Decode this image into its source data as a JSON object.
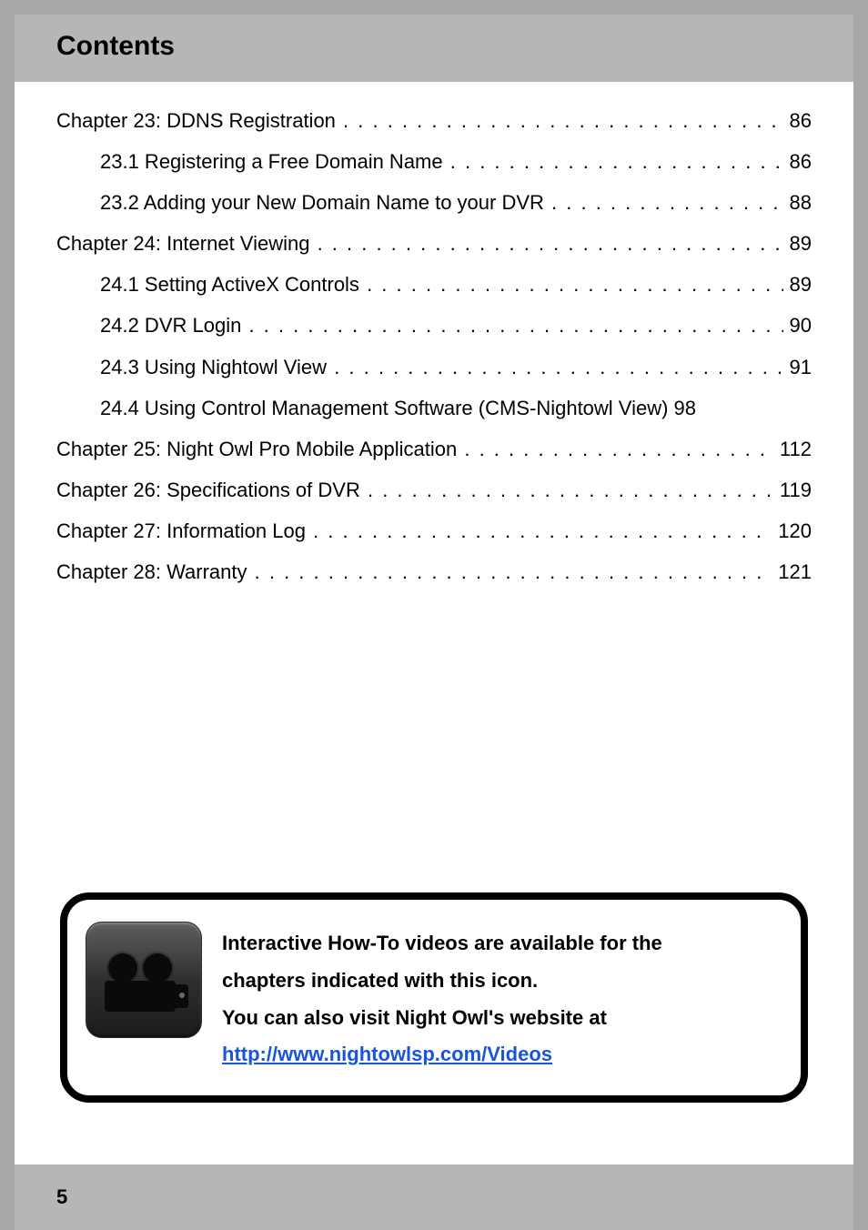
{
  "header": {
    "title": "Contents"
  },
  "toc": [
    {
      "indent": false,
      "title": "Chapter 23: DDNS Registration",
      "page": "86",
      "leader": true
    },
    {
      "indent": true,
      "title": "23.1 Registering a Free Domain Name",
      "page": "86",
      "leader": true
    },
    {
      "indent": true,
      "title": "23.2 Adding your New Domain Name to your DVR",
      "page": "88",
      "leader": true
    },
    {
      "indent": false,
      "title": "Chapter 24: Internet Viewing",
      "page": "89",
      "leader": true
    },
    {
      "indent": true,
      "title": "24.1 Setting ActiveX Controls",
      "page": "89",
      "leader": true
    },
    {
      "indent": true,
      "title": "24.2 DVR Login",
      "page": "90",
      "leader": true
    },
    {
      "indent": true,
      "title": "24.3 Using Nightowl View",
      "page": "91",
      "leader": true
    },
    {
      "indent": true,
      "title": "24.4 Using Control Management Software (CMS-Nightowl View)",
      "page": "98",
      "leader": false
    },
    {
      "indent": false,
      "title": "Chapter 25: Night Owl Pro Mobile Application",
      "page": "112",
      "leader": true
    },
    {
      "indent": false,
      "title": "Chapter 26: Specifications of DVR",
      "page": "119",
      "leader": true
    },
    {
      "indent": false,
      "title": "Chapter 27: Information Log",
      "page": "120",
      "leader": true
    },
    {
      "indent": false,
      "title": "Chapter 28: Warranty",
      "page": "121",
      "leader": true
    }
  ],
  "callout": {
    "line1": "Interactive How-To videos are available for the",
    "line2": "chapters indicated with this icon.",
    "line3": "You can also visit Night Owl's website at",
    "link_text": "http://www.nightowlsp.com/Videos",
    "link_href": "http://www.nightowlsp.com/Videos"
  },
  "footer": {
    "page_number": "5"
  }
}
